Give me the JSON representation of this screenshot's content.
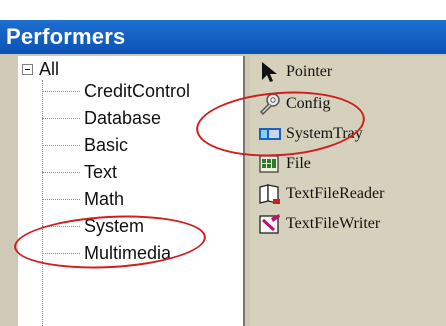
{
  "header": {
    "title": "Performers"
  },
  "tree": {
    "root_label": "All",
    "items": [
      {
        "label": "CreditControl"
      },
      {
        "label": "Database"
      },
      {
        "label": "Basic"
      },
      {
        "label": "Text"
      },
      {
        "label": "Math"
      },
      {
        "label": "System"
      },
      {
        "label": "Multimedia"
      }
    ]
  },
  "palette": {
    "items": [
      {
        "label": "Pointer",
        "icon": "pointer-arrow-icon"
      },
      {
        "label": "Config",
        "icon": "wrench-icon"
      },
      {
        "label": "SystemTray",
        "icon": "system-tray-icon"
      },
      {
        "label": "File",
        "icon": "file-grid-icon"
      },
      {
        "label": "TextFileReader",
        "icon": "text-file-reader-icon"
      },
      {
        "label": "TextFileWriter",
        "icon": "text-file-writer-icon"
      }
    ]
  },
  "annotations": {
    "highlight_color": "#d01e1e"
  }
}
